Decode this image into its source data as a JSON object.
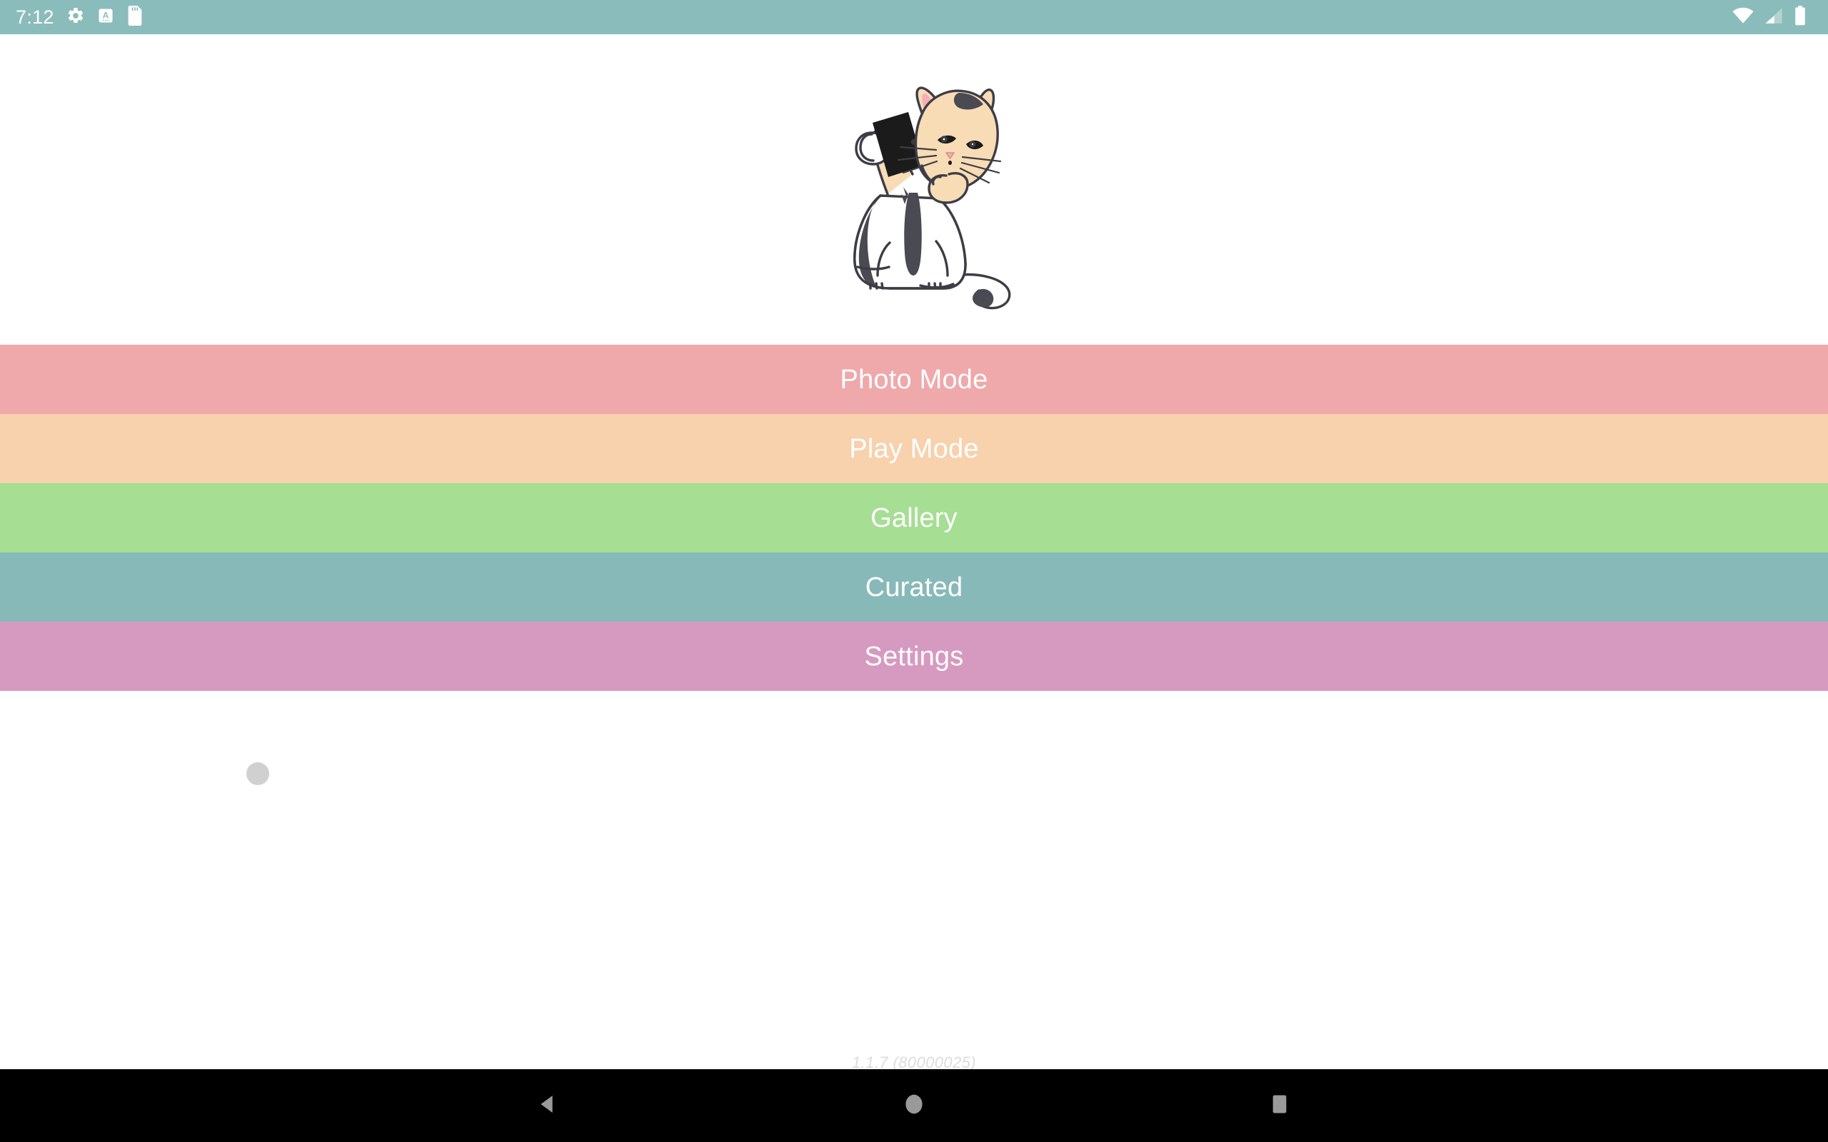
{
  "status_bar": {
    "background_color": "#8bbcbc",
    "clock": "7:12",
    "left_icons": [
      {
        "name": "gear-icon",
        "label": "Settings"
      },
      {
        "name": "assistant-a-icon",
        "label": "Text Assistant"
      },
      {
        "name": "sd-card-icon",
        "label": "SD Card"
      }
    ],
    "right_icons": [
      {
        "name": "wifi-icon",
        "label": "Wi-Fi"
      },
      {
        "name": "cellular-signal-icon",
        "label": "Cellular Signal"
      },
      {
        "name": "battery-icon",
        "label": "Battery"
      }
    ]
  },
  "hero": {
    "illustration_name": "cat-taking-selfie-illustration",
    "colors": {
      "fur_cream": "#f7dcb5",
      "outline": "#3d3d46",
      "patch_dark": "#4a4a52",
      "ear_pink": "#f7aeb4",
      "phone_black": "#1b1b1b",
      "flash_orange": "#f08a4b",
      "body_white": "#ffffff"
    }
  },
  "menu": {
    "items": [
      {
        "label": "Photo Mode",
        "color": "#efa9ab",
        "name": "menu-item-photo-mode"
      },
      {
        "label": "Play Mode",
        "color": "#f8d1ad",
        "name": "menu-item-play-mode"
      },
      {
        "label": "Gallery",
        "color": "#a6de94",
        "name": "menu-item-gallery"
      },
      {
        "label": "Curated",
        "color": "#88b9b9",
        "name": "menu-item-curated"
      },
      {
        "label": "Settings",
        "color": "#d69ac1",
        "name": "menu-item-settings"
      }
    ],
    "text_color": "#ffffff"
  },
  "content": {
    "cursor_dot_color": "#d0d0d0",
    "version": "1.1.7 (80000025)"
  },
  "nav_bar": {
    "background_color": "#000000",
    "buttons": [
      {
        "name": "nav-back-button",
        "label": "Back"
      },
      {
        "name": "nav-home-button",
        "label": "Home"
      },
      {
        "name": "nav-recents-button",
        "label": "Recent apps"
      }
    ],
    "icon_color": "#9a9a9a"
  }
}
